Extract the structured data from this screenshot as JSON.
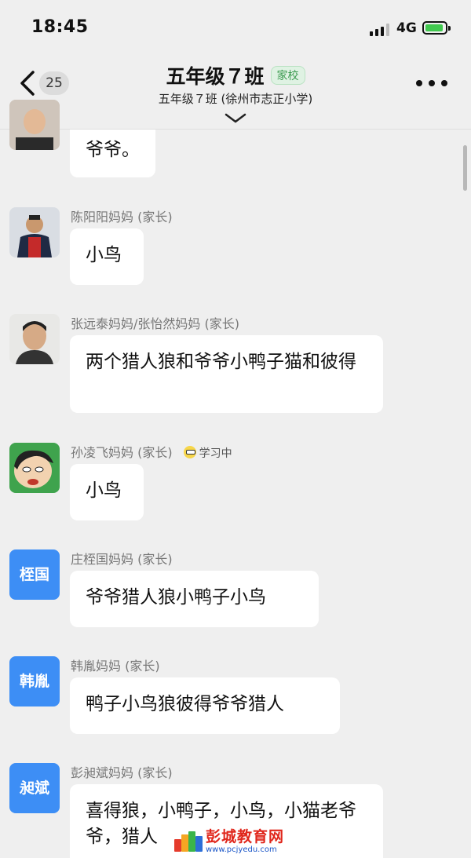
{
  "status_bar": {
    "time": "18:45",
    "network": "4G"
  },
  "header": {
    "back_count": "25",
    "title": "五年级７班",
    "tag": "家校",
    "subtitle": "五年级７班 (徐州市志正小学)"
  },
  "messages": [
    {
      "sender": "",
      "text": "爷爷。"
    },
    {
      "sender": "陈阳阳妈妈 (家长)",
      "text": "小鸟"
    },
    {
      "sender": "张远泰妈妈/张怡然妈妈 (家长)",
      "text": "两个猎人狼和爷爷小鸭子猫和彼得"
    },
    {
      "sender": "孙凌飞妈妈 (家长)",
      "status": "学习中",
      "text": "小鸟"
    },
    {
      "sender": "庄桎国妈妈 (家长)",
      "avatar_text": "桎国",
      "text": "爷爷猎人狼小鸭子小鸟"
    },
    {
      "sender": "韩胤妈妈 (家长)",
      "avatar_text": "韩胤",
      "text": "鸭子小鸟狼彼得爷爷猎人"
    },
    {
      "sender": "彭昶斌妈妈 (家长)",
      "avatar_text": "昶斌",
      "text": "喜得狼，小鸭子，小鸟，小猫老爷爷，猎人"
    }
  ],
  "watermark": {
    "name": "彭城教育网",
    "url": "www.pcjyedu.com"
  },
  "colors": {
    "background": "#efefef",
    "bubble": "#ffffff",
    "avatar_blue": "#3d8ef5",
    "tag_green": "#3b9a4f"
  }
}
